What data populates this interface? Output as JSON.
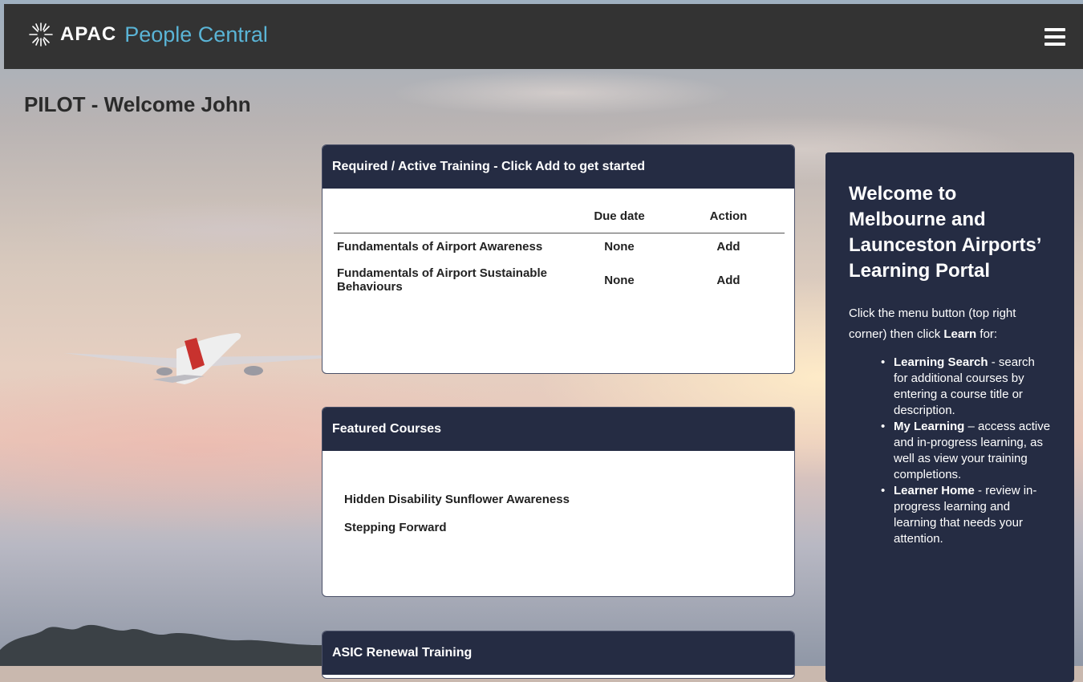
{
  "header": {
    "brand": "APAC",
    "product": "People Central",
    "menu_icon": "hamburger-menu-icon"
  },
  "page": {
    "title": "PILOT - Welcome John"
  },
  "required_training": {
    "heading": "Required / Active Training - Click Add to get started",
    "columns": [
      "",
      "Due date",
      "Action"
    ],
    "rows": [
      {
        "course": "Fundamentals of Airport Awareness",
        "due": "None",
        "action": "Add"
      },
      {
        "course": "Fundamentals of Airport Sustainable Behaviours",
        "due": "None",
        "action": "Add"
      }
    ]
  },
  "featured": {
    "heading": "Featured Courses",
    "items": [
      "Hidden Disability Sunflower Awareness",
      "Stepping Forward"
    ]
  },
  "asic": {
    "heading": "ASIC Renewal Training"
  },
  "sidebar": {
    "title": "Welcome to Melbourne and Launceston Airports’ Learning Portal",
    "intro_before": "Click the menu button (top right corner) then click ",
    "intro_strong": "Learn",
    "intro_after": " for:",
    "items": [
      {
        "strong": "Learning Search",
        "text": " - search for additional courses by entering a course title or description."
      },
      {
        "strong": "My Learning",
        "text": " – access active and in-progress learning, as well as view your training completions."
      },
      {
        "strong": "Learner Home",
        "text": " - review in-progress learning and learning that needs your attention."
      }
    ]
  },
  "colors": {
    "header_bg": "#333333",
    "panel_head_bg": "#252c43",
    "brand_accent": "#5ab4d6"
  }
}
